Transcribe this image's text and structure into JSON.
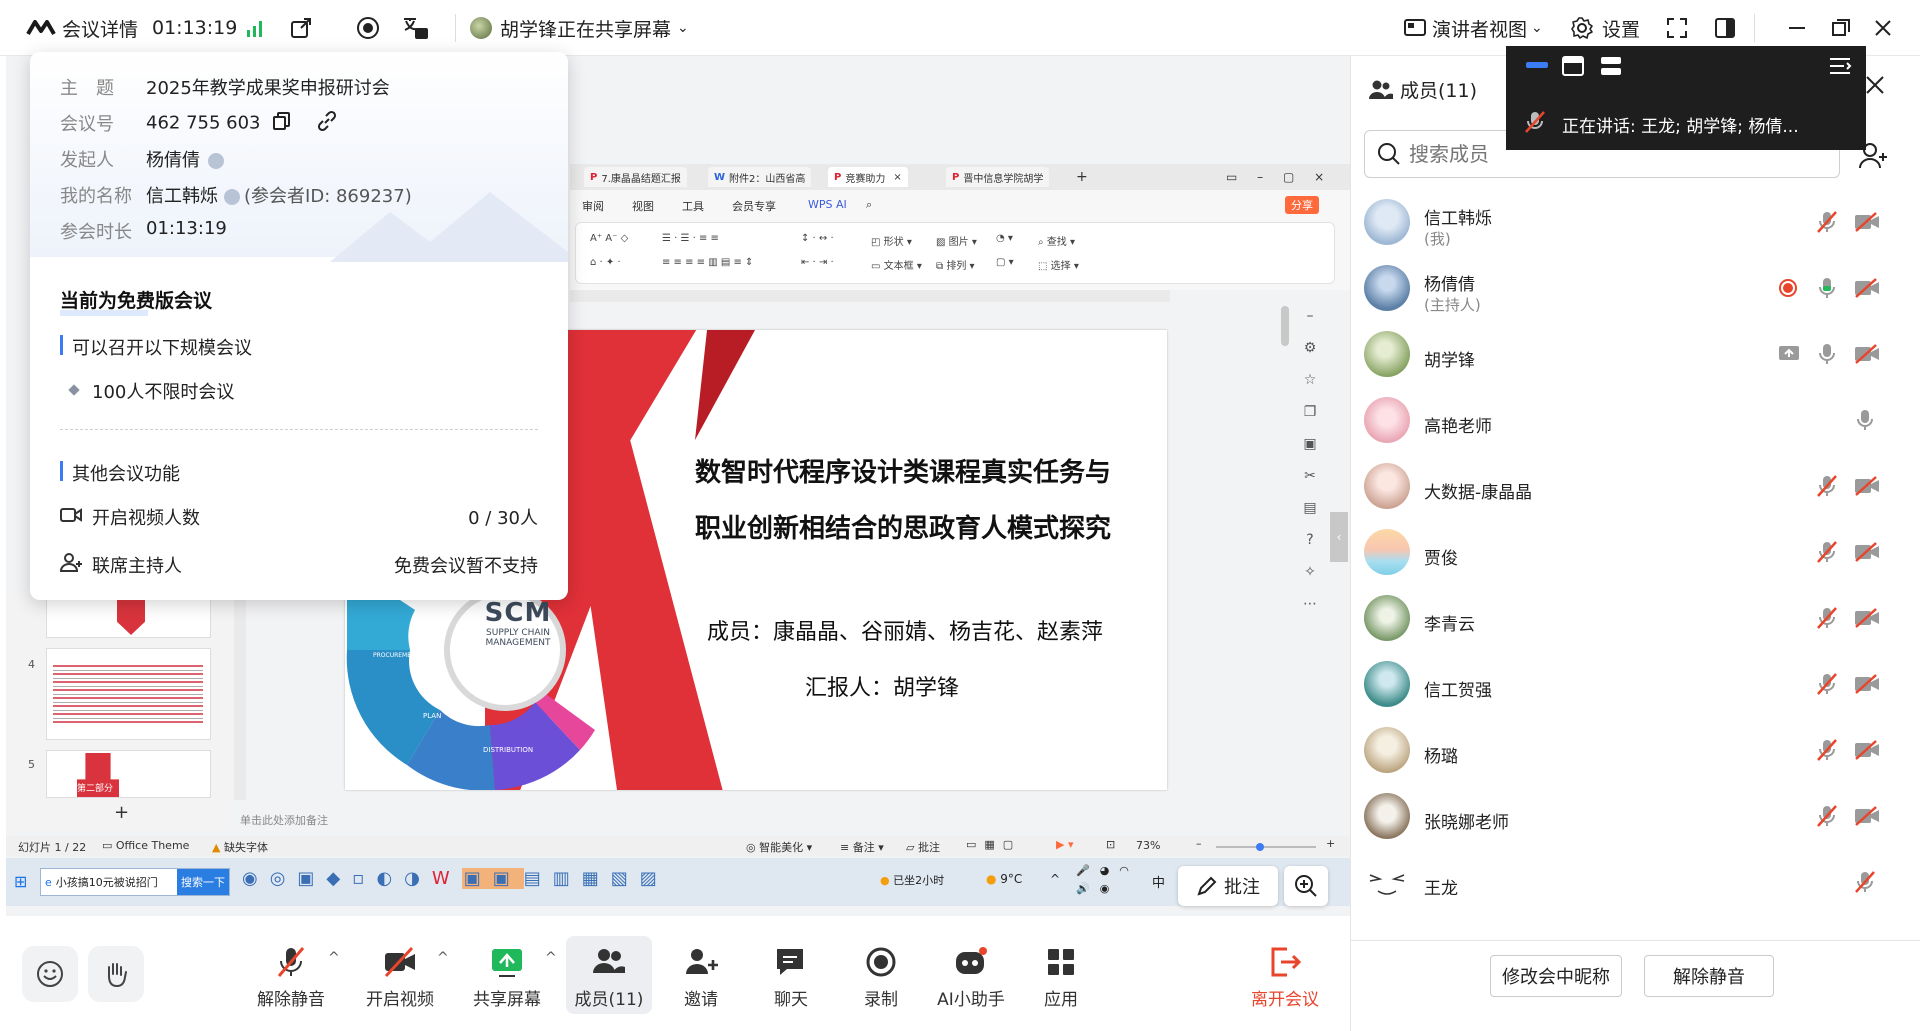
{
  "topbar": {
    "meeting_details": "会议详情",
    "elapsed": "01:13:19",
    "sharer": "胡学锋正在共享屏幕",
    "presenter_view": "演讲者视图",
    "settings": "设置"
  },
  "popup": {
    "topic_label": "主　题",
    "topic_value": "2025年教学成果奖申报研讨会",
    "meeting_id_label": "会议号",
    "meeting_id_value": "462 755 603",
    "organizer_label": "发起人",
    "organizer_value": "杨倩倩",
    "my_name_label": "我的名称",
    "my_name_value": "信工韩烁",
    "participant_id": "(参会者ID: 869237)",
    "duration_label": "参会时长",
    "duration_value": "01:13:19",
    "free_title": "当前为免费版会议",
    "scale_title": "可以召开以下规模会议",
    "scale_item": "100人不限时会议",
    "other_title": "其他会议功能",
    "video_label": "开启视频人数",
    "video_value": "0 / 30人",
    "cohost_label": "联席主持人",
    "cohost_value": "免费会议暂不支持"
  },
  "wps": {
    "tabs": [
      "7.康晶晶结题汇报",
      "附件2：山西省高",
      "竞赛助力",
      "晋中信息学院胡学"
    ],
    "ribbon_menus": [
      "审阅",
      "视图",
      "工具",
      "会员专享",
      "WPS AI"
    ],
    "tool_shape": "形状",
    "tool_picture": "图片",
    "tool_textbox": "文本框",
    "tool_arrange": "排列",
    "tool_find": "查找",
    "tool_select": "选择",
    "share": "分享",
    "slide_title_1": "数智时代程序设计类课程真实任务与",
    "slide_title_2": "职业创新相结合的思政育人模式探究",
    "slide_members": "成员：康晶晶、谷丽婧、杨吉花、赵素萍",
    "slide_reporter": "汇报人：胡学锋",
    "scm_main": "SCM",
    "scm_sub1": "SUPPLY CHAIN",
    "scm_sub2": "MANAGEMENT",
    "scm_plan": "PLAN",
    "scm_distribution": "DISTRIBUTION",
    "scm_procurement": "PROCUREMENT",
    "thumb_4": "4",
    "thumb_5": "5",
    "thumb_5_label": "第二部分",
    "notes_hint": "单击此处添加备注",
    "status_slide": "幻灯片 1 / 22",
    "status_theme": "Office Theme",
    "status_font": "缺失字体",
    "status_beautify": "智能美化",
    "status_notes": "备注",
    "status_comment": "批注",
    "status_zoom": "73%",
    "taskbar_search": "小孩搞10元被说招门",
    "taskbar_search_btn": "搜索一下",
    "taskbar_sit": "已坐2小时",
    "taskbar_temp": "9°C",
    "taskbar_ime": "中",
    "annotate": "批注"
  },
  "controls": {
    "unmute": "解除静音",
    "start_video": "开启视频",
    "share_screen": "共享屏幕",
    "members": "成员(11)",
    "invite": "邀请",
    "chat": "聊天",
    "record": "录制",
    "ai_assistant": "AI小助手",
    "apps": "应用",
    "leave": "离开会议"
  },
  "panel": {
    "title": "成员(11)",
    "search_placeholder": "搜索成员",
    "speaking_label": "正在讲话:",
    "speaking_names": "王龙; 胡学锋; 杨倩...",
    "members": [
      {
        "name": "信工韩烁",
        "sub": "(我)"
      },
      {
        "name": "杨倩倩",
        "sub": "(主持人)"
      },
      {
        "name": "胡学锋",
        "sub": ""
      },
      {
        "name": "高艳老师",
        "sub": ""
      },
      {
        "name": "大数据-康晶晶",
        "sub": ""
      },
      {
        "name": "贾俊",
        "sub": ""
      },
      {
        "name": "李青云",
        "sub": ""
      },
      {
        "name": "信工贺强",
        "sub": ""
      },
      {
        "name": "杨璐",
        "sub": ""
      },
      {
        "name": "张晓娜老师",
        "sub": ""
      },
      {
        "name": "王龙",
        "sub": ""
      }
    ],
    "rename_button": "修改会中昵称",
    "unmute_button": "解除静音"
  },
  "colors": {
    "accent_blue": "#3b7cf5",
    "signal_green": "#1fb85a",
    "leave_red": "#e8452c",
    "slide_red": "#e03038"
  }
}
